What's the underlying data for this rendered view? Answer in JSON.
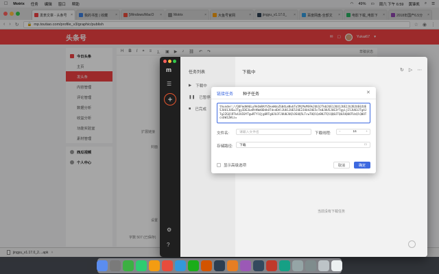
{
  "menubar": {
    "app": "Motrix",
    "items": [
      "任务",
      "编辑",
      "窗口",
      "帮助"
    ],
    "battery": "49%",
    "clock": "周六 下午 6:59",
    "user": "黄锋凯"
  },
  "tabs": [
    {
      "label": "发表文章 - 头条号",
      "color": "#f04142",
      "active": true
    },
    {
      "label": "我的书签 | 收藏",
      "color": "#3b7ddd",
      "active": false
    },
    {
      "label": "[Windows/MacO",
      "color": "#e74c3c",
      "active": false
    },
    {
      "label": "Motrix",
      "color": "#888888",
      "active": false
    },
    {
      "label": "大鱼号官网",
      "color": "#f39c12",
      "active": false
    },
    {
      "label": "jingyu_v1.17.0_",
      "color": "#2c3e50",
      "active": false
    },
    {
      "label": "百度网盘-全部文",
      "color": "#3498db",
      "active": false
    },
    {
      "label": "电影下载_电影下",
      "color": "#27ae60",
      "active": false
    },
    {
      "label": "2018年国产6.5分",
      "color": "#8e44ad",
      "active": false
    }
  ],
  "address": {
    "url": "mp.toutiao.com/profile_v3/graphic/publish"
  },
  "header": {
    "logo": "头条号",
    "user": "Yukai67"
  },
  "sidebar": {
    "section1": "今日头条",
    "items": [
      "主页",
      "发头条",
      "内容管理",
      "评论管理",
      "数据分析",
      "收益分析",
      "功能实验室",
      "素材管理"
    ],
    "active_index": 1,
    "section2": "西瓜视频",
    "section3": "个人中心"
  },
  "editor": {
    "draft_label": "草稿状态",
    "hint1": "扩展链接",
    "hint2": "封面",
    "hint3": "设置",
    "wordcount": "字数 507 (已保存)"
  },
  "downloadbar": {
    "file": "jingyu_v1.17.0_2....apk"
  },
  "motrix": {
    "list_title": "任务列表",
    "list_items": [
      "下载中",
      "已暂停",
      "已完成"
    ],
    "main_title": "下载中",
    "empty_text": "当前没有下载任务"
  },
  "dialog": {
    "tabs": [
      "链接任务",
      "种子任务"
    ],
    "active_tab": 0,
    "link_text": "thunder://QUFmdHA6Ly9kOmRAYS5keWdoZG04LmNvbTo5MjMxMS9kJUU3JTk0JUE1JUU1JUE2JUJBJUE0JUE5JUU1JUEwJTgyIDE3LmRtKWdODdkOTdsdDAlJUU1JUE5JUE2JUU4JUE5cTk0JUU5JUE3YTgyLjI5JUU3JTg4JTg2ZGQlRTk4JUI0YTgwRTYlQjg0RTg0JUJFJUU0JUQlOSUQ5LTcwTUQlQzBKJTQlQQ0JTQ0JUQ0OTUzQlQ0OTcsbW12Wiz=",
    "filename_label": "文件名:",
    "filename_placeholder": "请输入文件名",
    "threads_label": "下载线程:",
    "threads_value": "16",
    "path_label": "存储路径:",
    "path_value": "下载",
    "advanced_label": "显示高级选项",
    "cancel_label": "取消",
    "ok_label": "确定",
    "accent": "#3d69e0"
  }
}
